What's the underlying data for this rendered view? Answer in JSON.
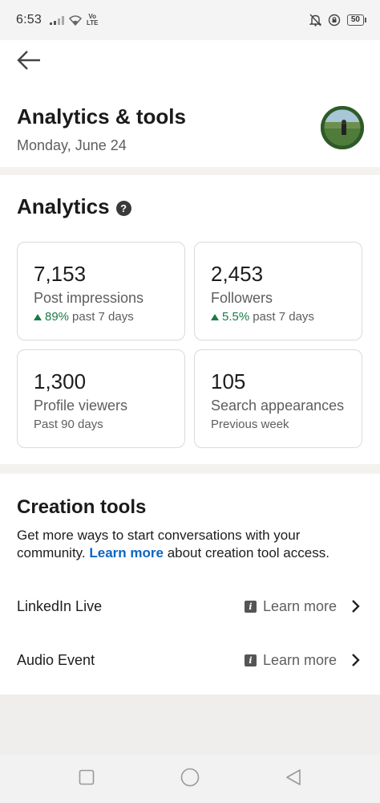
{
  "status_bar": {
    "time": "6:53",
    "network_label_top": "Vo",
    "network_label_bottom": "LTE",
    "battery": "50"
  },
  "header": {
    "title": "Analytics & tools",
    "date": "Monday, June 24"
  },
  "analytics": {
    "title": "Analytics",
    "help_icon": "?",
    "metrics": [
      {
        "value": "7,153",
        "label": "Post impressions",
        "change": "89%",
        "period": "past 7 days",
        "trend": "up"
      },
      {
        "value": "2,453",
        "label": "Followers",
        "change": "5.5%",
        "period": "past 7 days",
        "trend": "up"
      },
      {
        "value": "1,300",
        "label": "Profile viewers",
        "period": "Past 90 days"
      },
      {
        "value": "105",
        "label": "Search appearances",
        "period": "Previous week"
      }
    ]
  },
  "creation_tools": {
    "title": "Creation tools",
    "desc_before": "Get more ways to start conversations with your community. ",
    "desc_link": "Learn more",
    "desc_after": " about creation tool access.",
    "items": [
      {
        "name": "LinkedIn Live",
        "learn": "Learn more",
        "info_icon": "i"
      },
      {
        "name": "Audio Event",
        "learn": "Learn more",
        "info_icon": "i"
      }
    ]
  },
  "colors": {
    "accent_link": "#0a66c2",
    "trend_green": "#1b7a44",
    "page_bg": "#f4f2ee"
  }
}
